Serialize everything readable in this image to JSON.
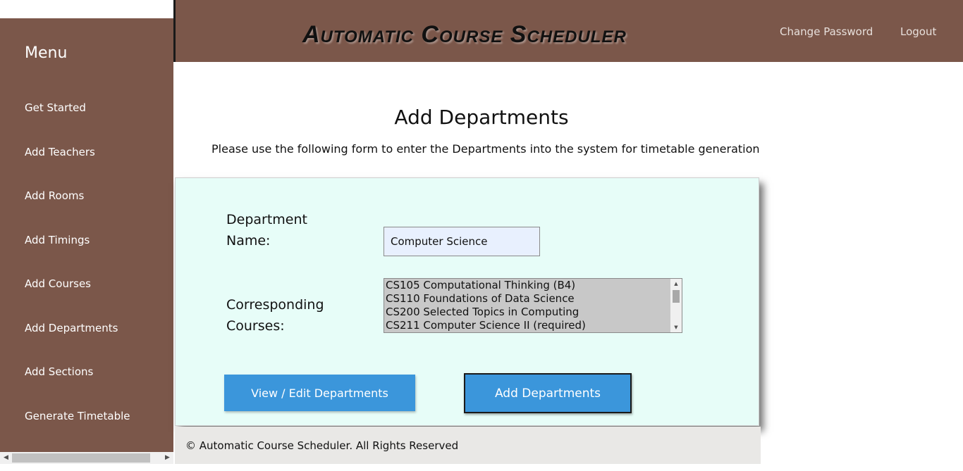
{
  "sidebar": {
    "title": "Menu",
    "items": [
      {
        "label": "Get Started"
      },
      {
        "label": "Add Teachers"
      },
      {
        "label": "Add Rooms"
      },
      {
        "label": "Add Timings"
      },
      {
        "label": "Add Courses"
      },
      {
        "label": "Add Departments"
      },
      {
        "label": "Add Sections"
      },
      {
        "label": "Generate Timetable"
      }
    ]
  },
  "header": {
    "title": "Automatic Course Scheduler",
    "links": {
      "change_password": "Change Password",
      "logout": "Logout"
    },
    "background_color": "#7b574a"
  },
  "main": {
    "heading": "Add Departments",
    "description": "Please use the following form to enter the Departments into the system for timetable generation"
  },
  "form": {
    "department_name_label": "Department Name:",
    "department_name_value": "Computer Science",
    "courses_label": "Corresponding Courses:",
    "courses_options": [
      "CS105 Computational Thinking (B4)",
      "CS110 Foundations of Data Science",
      "CS200 Selected Topics in Computing",
      "CS211 Computer Science II (required)"
    ],
    "view_button": "View / Edit Departments",
    "add_button": "Add Departments",
    "panel_color": "#e7fdf8",
    "button_color": "#3b96db"
  },
  "footer": {
    "text": "© Automatic Course Scheduler. All Rights Reserved"
  }
}
